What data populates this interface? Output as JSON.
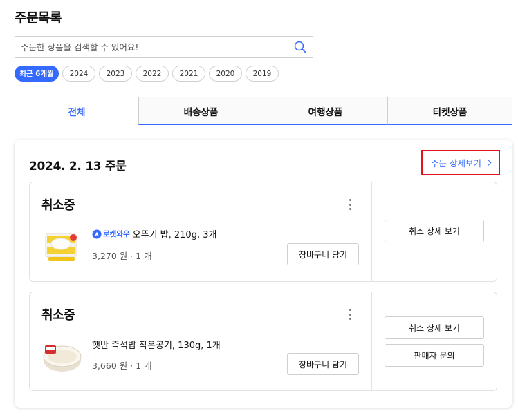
{
  "page_title": "주문목록",
  "search": {
    "placeholder": "주문한 상품을 검색할 수 있어요!"
  },
  "years": [
    "최근 6개월",
    "2024",
    "2023",
    "2022",
    "2021",
    "2020",
    "2019"
  ],
  "tabs": [
    "전체",
    "배송상품",
    "여행상품",
    "티켓상품"
  ],
  "order": {
    "date": "2024. 2. 13 주문",
    "detail_link": "주문 상세보기",
    "items": [
      {
        "status": "취소중",
        "badge": "로켓와우",
        "name": "오뚜기 밥, 210g, 3개",
        "price": "3,270 원 · 1 개",
        "cart_button": "장바구니 담기",
        "actions": [
          "취소 상세 보기"
        ]
      },
      {
        "status": "취소중",
        "name": "햇반 즉석밥 작은공기, 130g, 1개",
        "price": "3,660 원 · 1 개",
        "cart_button": "장바구니 담기",
        "actions": [
          "취소 상세 보기",
          "판매자 문의"
        ]
      }
    ]
  },
  "colors": {
    "accent": "#346aff",
    "highlight_border": "#e2131f",
    "border": "#e2e2e2"
  }
}
